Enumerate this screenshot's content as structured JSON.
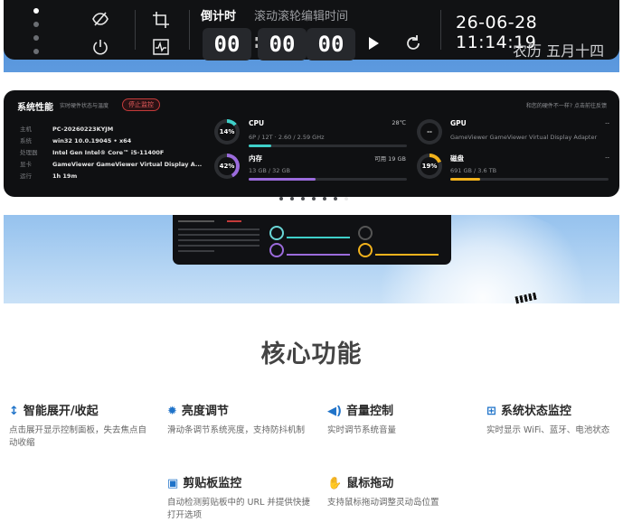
{
  "topbar": {
    "countdown_label": "倒计时",
    "countdown_hint": "滚动滚轮编辑时间",
    "hours": "00",
    "minutes": "00",
    "seconds": "00",
    "datetime": "26-06-28 11:14:19",
    "lunar": "农历 五月十四",
    "icons": [
      "eye-slash-icon",
      "power-icon",
      "crop-icon",
      "activity-icon",
      "play-icon",
      "refresh-icon"
    ]
  },
  "perf": {
    "title": "系统性能",
    "subtitle": "实时硬件状态与温度",
    "stop_label": "停止监控",
    "help_text": "和您的硬件不一样? 点击前往反馈",
    "system_info": [
      {
        "key": "主机",
        "value": "PC-20260223KYJM"
      },
      {
        "key": "系统",
        "value": "win32 10.0.19045 • x64"
      },
      {
        "key": "处理器",
        "value": "Intel Gen Intel® Core™ i5-11400F"
      },
      {
        "key": "显卡",
        "value": "GameViewer GameViewer Virtual Display A..."
      },
      {
        "key": "运行",
        "value": "1h 19m"
      }
    ],
    "cpu": {
      "name": "CPU",
      "percent": "14%",
      "temp": "28℃",
      "detail": "6P / 12T · 2.60 / 2.59 GHz",
      "fill": 0.14
    },
    "memory": {
      "name": "内存",
      "percent": "42%",
      "available": "可用 19 GB",
      "detail": "13 GB / 32 GB",
      "fill": 0.42
    },
    "gpu": {
      "name": "GPU",
      "percent": "--",
      "right": "--",
      "detail": "GameViewer GameViewer Virtual Display Adapter",
      "fill": 0
    },
    "disk": {
      "name": "磁盘",
      "percent": "19%",
      "right": "--",
      "detail": "691 GB / 3.6 TB",
      "fill": 0.19
    },
    "page_dots": 7,
    "active_dot": 6
  },
  "colors": {
    "cpu_ring": "#3fd0c9",
    "mem_ring": "#9b6bdc",
    "disk_ring": "#f2b21c",
    "accent_blue": "#1f73c9"
  },
  "features": {
    "heading": "核心功能",
    "items": [
      {
        "icon": "expand-icon",
        "title": "智能展开/收起",
        "desc": "点击展开显示控制面板，失去焦点自动收缩"
      },
      {
        "icon": "sun-icon",
        "title": "亮度调节",
        "desc": "滑动条调节系统亮度，支持防抖机制"
      },
      {
        "icon": "volume-icon",
        "title": "音量控制",
        "desc": "实时调节系统音量"
      },
      {
        "icon": "network-icon",
        "title": "系统状态监控",
        "desc": "实时显示 WiFi、蓝牙、电池状态"
      },
      {
        "icon": "clipboard-icon",
        "title": "剪贴板监控",
        "desc": "自动检测剪贴板中的 URL 并提供快捷打开选项"
      },
      {
        "icon": "hand-icon",
        "title": "鼠标拖动",
        "desc": "支持鼠标拖动调整灵动岛位置"
      }
    ]
  }
}
